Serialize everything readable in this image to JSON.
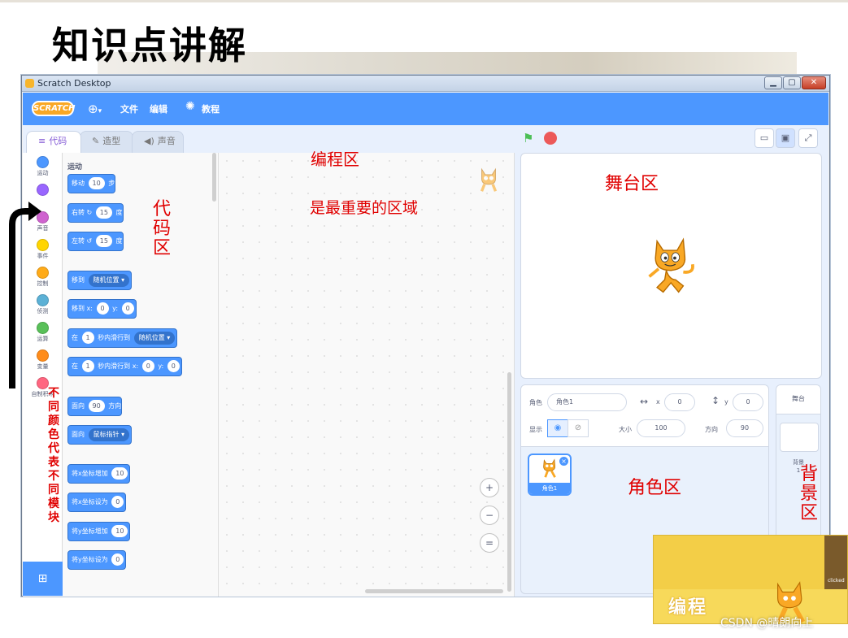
{
  "slide": {
    "title": "知识点讲解"
  },
  "window": {
    "title": "Scratch Desktop",
    "min_label": "▁",
    "max_label": "▢",
    "close_label": "✕"
  },
  "menubar": {
    "logo": "SCRATCH",
    "globe_icon": "globe-icon",
    "items": [
      "文件",
      "编辑",
      "教程"
    ]
  },
  "tabs": [
    {
      "label": "代码",
      "icon": "code-icon",
      "active": true
    },
    {
      "label": "造型",
      "icon": "brush-icon",
      "active": false
    },
    {
      "label": "声音",
      "icon": "speaker-icon",
      "active": false
    }
  ],
  "categories": [
    {
      "label": "运动",
      "color": "#4c97ff"
    },
    {
      "label": "",
      "color": "#9966ff"
    },
    {
      "label": "声音",
      "color": "#cf63cf"
    },
    {
      "label": "事件",
      "color": "#ffd500"
    },
    {
      "label": "控制",
      "color": "#ffab19"
    },
    {
      "label": "侦测",
      "color": "#5cb1d6"
    },
    {
      "label": "运算",
      "color": "#59c059"
    },
    {
      "label": "变量",
      "color": "#ff8c1a"
    },
    {
      "label": "自制积木",
      "color": "#ff6680"
    }
  ],
  "palette": {
    "section_title": "运动",
    "blocks": {
      "move": {
        "a": "移动",
        "v": "10",
        "b": "步"
      },
      "turn_right": {
        "a": "右转",
        "icon": "↻",
        "v": "15",
        "b": "度"
      },
      "turn_left": {
        "a": "左转",
        "icon": "↺",
        "v": "15",
        "b": "度"
      },
      "goto": {
        "a": "移到",
        "drop": "随机位置 ▾"
      },
      "goto_xy": {
        "a": "移到 x:",
        "x": "0",
        "mid": "y:",
        "y": "0"
      },
      "glide": {
        "a": "在",
        "v": "1",
        "mid": "秒内滑行到",
        "drop": "随机位置 ▾"
      },
      "glide_xy": {
        "a": "在",
        "v": "1",
        "mid": "秒内滑行到 x:",
        "x": "0",
        "mid2": "y:",
        "y": "0"
      },
      "point_dir": {
        "a": "面向",
        "v": "90",
        "b": "方向"
      },
      "point_towards": {
        "a": "面向",
        "drop": "鼠标指针 ▾"
      },
      "change_x": {
        "a": "将x坐标增加",
        "v": "10"
      },
      "set_x": {
        "a": "将x坐标设为",
        "v": "0"
      },
      "change_y": {
        "a": "将y坐标增加",
        "v": "10"
      },
      "set_y": {
        "a": "将y坐标设为",
        "v": "0"
      }
    }
  },
  "script_area": {
    "zoom_in": "+",
    "zoom_out": "−",
    "zoom_reset": "="
  },
  "sprite_info": {
    "sprite_label": "角色",
    "sprite_name": "角色1",
    "x_label": "x",
    "x_value": "0",
    "y_label": "y",
    "y_value": "0",
    "show_label": "显示",
    "size_label": "大小",
    "size_value": "100",
    "direction_label": "方向",
    "direction_value": "90",
    "tile_name": "角色1"
  },
  "stage_pane": {
    "title": "舞台",
    "backdrops_label": "背景",
    "backdrops_count": "1"
  },
  "annotations": {
    "code_area_title": "编程区",
    "code_area_note": "是最重要的区域",
    "code_area_chars": [
      "代",
      "码",
      "区"
    ],
    "stage_area": "舞台区",
    "sprite_area": "角色区",
    "backdrop_chars": [
      "背",
      "景",
      "区"
    ],
    "modules_chars": [
      "不",
      "同",
      "颜",
      "色",
      "代",
      "表",
      "不",
      "同",
      "模",
      "块"
    ]
  },
  "corner_art": {
    "word": "编程",
    "clicked": "clicked"
  },
  "watermark": "CSDN @晴朗向上"
}
